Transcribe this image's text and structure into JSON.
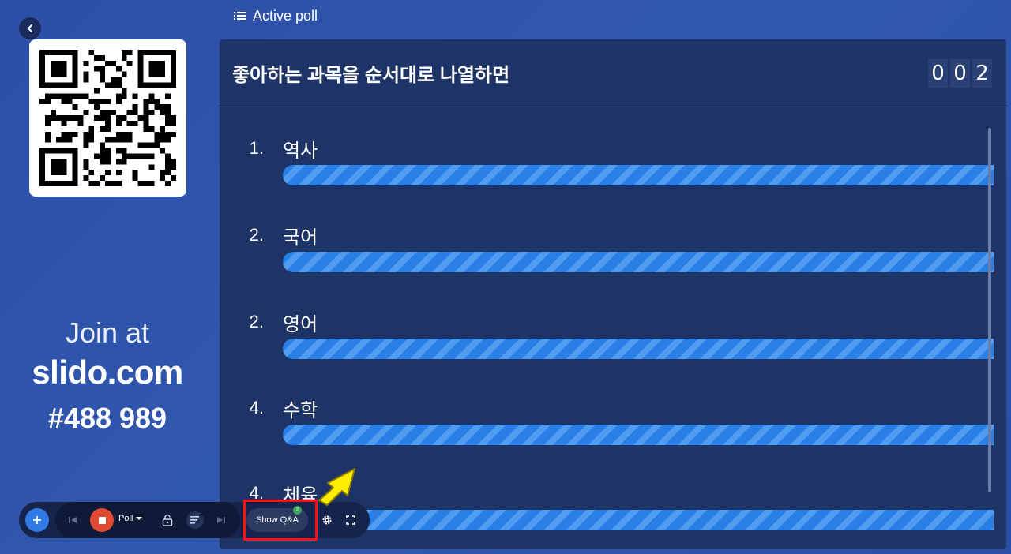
{
  "header": {
    "title": "Active poll"
  },
  "join": {
    "line1": "Join at",
    "url": "slido.com",
    "code": "#488 989"
  },
  "poll": {
    "question": "좋아하는 과목을 순서대로 나열하면",
    "counter": [
      "0",
      "0",
      "2"
    ],
    "items": [
      {
        "rank": "1.",
        "label": "역사"
      },
      {
        "rank": "2.",
        "label": "국어"
      },
      {
        "rank": "2.",
        "label": "영어"
      },
      {
        "rank": "4.",
        "label": "수학"
      },
      {
        "rank": "4.",
        "label": "체육"
      }
    ]
  },
  "toolbar": {
    "poll_label": "Poll",
    "qa_label": "Show Q&A",
    "qa_badge": "2"
  },
  "colors": {
    "background": "#2c4fa6",
    "panel": "#1f3466",
    "bar": "#2a7fe6",
    "record": "#e04a32",
    "highlight": "#ff1010",
    "arrow": "#ffee00"
  }
}
